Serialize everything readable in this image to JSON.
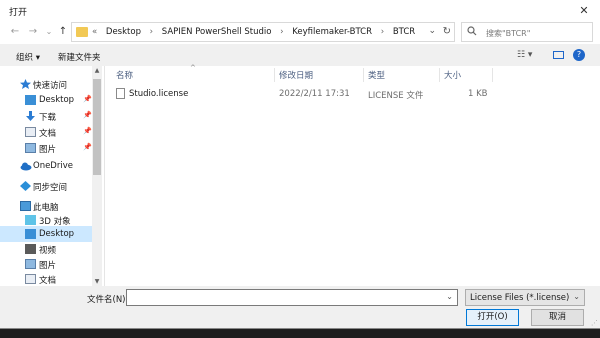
{
  "window": {
    "title": "打开",
    "close": "✕"
  },
  "nav": {
    "back": "←",
    "forward": "→",
    "recent": "⌄",
    "up": "↑"
  },
  "address": {
    "overflow": "«",
    "sep": "›",
    "crumbs": [
      "Desktop",
      "SAPIEN PowerShell Studio",
      "Keyfilemaker-BTCR",
      "BTCR"
    ],
    "dropdown": "⌄",
    "refresh": "↻"
  },
  "search": {
    "placeholder": "搜索\"BTCR\""
  },
  "toolbar": {
    "organize": "组织 ▾",
    "new_folder": "新建文件夹",
    "view": "☷ ▾"
  },
  "sidebar": {
    "items": [
      {
        "label": "快速访问",
        "icon": "star-icon",
        "pin": ""
      },
      {
        "label": "Desktop",
        "icon": "desktop-icon",
        "pin": "📌"
      },
      {
        "label": "下载",
        "icon": "download-icon",
        "pin": "📌"
      },
      {
        "label": "文档",
        "icon": "documents-icon",
        "pin": "📌"
      },
      {
        "label": "图片",
        "icon": "pictures-icon",
        "pin": "📌"
      },
      {
        "label": "OneDrive",
        "icon": "cloud-icon",
        "pin": ""
      },
      {
        "label": "同步空间",
        "icon": "sync-icon",
        "pin": ""
      },
      {
        "label": "此电脑",
        "icon": "pc-icon",
        "pin": ""
      },
      {
        "label": "3D 对象",
        "icon": "3d-objects-icon",
        "pin": ""
      },
      {
        "label": "Desktop",
        "icon": "desktop-icon",
        "pin": ""
      },
      {
        "label": "视频",
        "icon": "video-icon",
        "pin": ""
      },
      {
        "label": "图片",
        "icon": "pictures-icon",
        "pin": ""
      },
      {
        "label": "文档",
        "icon": "documents-icon",
        "pin": ""
      }
    ],
    "scroll_up": "▲",
    "scroll_down": "▼"
  },
  "columns": {
    "name": "名称",
    "modified": "修改日期",
    "type": "类型",
    "size": "大小",
    "sort_indicator": "^"
  },
  "files": [
    {
      "name": "Studio.license",
      "modified": "2022/2/11 17:31",
      "type": "LICENSE 文件",
      "size": "1 KB"
    }
  ],
  "footer": {
    "filename_label": "文件名(N):",
    "filename_value": "",
    "dropdown": "⌄",
    "filetype": "License Files (*.license)",
    "open": "打开(O)",
    "cancel": "取消"
  },
  "colors": {
    "accent": "#0078d7",
    "selection": "#cce8ff",
    "folder": "#f2c955"
  }
}
